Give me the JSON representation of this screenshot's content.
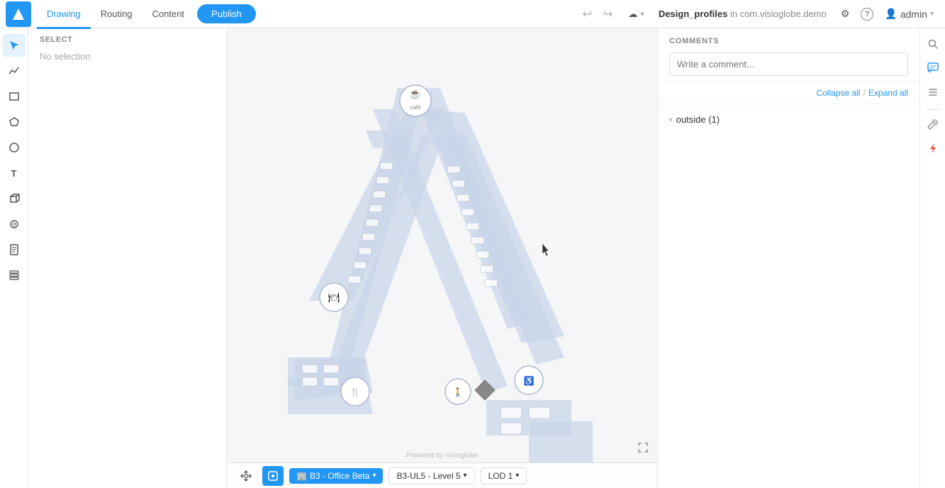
{
  "app": {
    "logo_label": "V"
  },
  "top_nav": {
    "tabs": [
      {
        "id": "drawing",
        "label": "Drawing",
        "active": true
      },
      {
        "id": "routing",
        "label": "Routing",
        "active": false
      },
      {
        "id": "content",
        "label": "Content",
        "active": false
      }
    ],
    "publish_label": "Publish",
    "document_name": "Design_profiles",
    "document_location": "in com.visioglobe.demo",
    "undo_icon": "↩",
    "redo_icon": "↪",
    "cloud_icon": "☁",
    "settings_icon": "⚙",
    "help_icon": "?",
    "user_icon": "👤",
    "user_name": "admin"
  },
  "left_toolbar": {
    "tools": [
      {
        "id": "select",
        "icon": "✦",
        "label": "select-tool",
        "active": true
      },
      {
        "id": "analytics",
        "icon": "📈",
        "label": "analytics-tool"
      },
      {
        "id": "rectangle",
        "icon": "▭",
        "label": "rectangle-tool"
      },
      {
        "id": "polygon",
        "icon": "⬟",
        "label": "polygon-tool"
      },
      {
        "id": "circle",
        "icon": "○",
        "label": "circle-tool"
      },
      {
        "id": "text",
        "icon": "T",
        "label": "text-tool"
      },
      {
        "id": "3d",
        "icon": "⬡",
        "label": "3d-tool"
      },
      {
        "id": "terrain",
        "icon": "◉",
        "label": "terrain-tool"
      },
      {
        "id": "document",
        "icon": "📄",
        "label": "document-tool"
      },
      {
        "id": "layers",
        "icon": "⬛",
        "label": "layers-tool"
      }
    ]
  },
  "left_panel": {
    "section_title": "SELECT",
    "no_selection_text": "No selection"
  },
  "canvas": {
    "floor_plan_color": "#c8d0e0",
    "bg_color": "#f5f6f8"
  },
  "bottom_bar": {
    "pan_icon": "✋",
    "select_icon": "⬜",
    "floor_label": "B3 - Office Beta",
    "floor_icon": "🏢",
    "level_label": "B3-UL5 - Level 5",
    "lod_label": "LOD 1",
    "fullscreen_icon": "⛶",
    "powered_by": "Powered by Visioglobe"
  },
  "right_panel": {
    "comments_title": "COMMENTS",
    "comment_placeholder": "Write a comment...",
    "collapse_label": "Collapse all",
    "expand_label": "Expand all",
    "separator": "/",
    "comment_groups": [
      {
        "id": "outside",
        "label": "outside (1)",
        "expanded": false
      }
    ]
  },
  "right_icon_bar": {
    "icons": [
      {
        "id": "search",
        "icon": "🔍",
        "label": "search-icon",
        "active": false
      },
      {
        "id": "chat",
        "icon": "💬",
        "label": "chat-icon",
        "active": true,
        "color": "blue"
      },
      {
        "id": "list",
        "icon": "☰",
        "label": "list-icon",
        "active": false
      },
      {
        "id": "tools",
        "icon": "🔧",
        "label": "tools-icon",
        "active": false
      },
      {
        "id": "lightning",
        "icon": "⚡",
        "label": "lightning-icon",
        "active": true,
        "color": "red"
      }
    ]
  }
}
